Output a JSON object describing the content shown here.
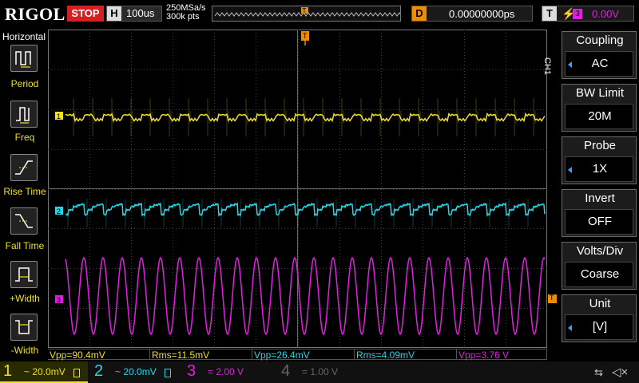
{
  "header": {
    "brand": "RIGOL",
    "run_state": "STOP",
    "horizontal_badge": "H",
    "timebase": "100us",
    "sample_rate": "250MSa/s",
    "memory_depth": "300k pts",
    "trigger_pos_marker": "T",
    "delay_badge": "D",
    "delay": "0.00000000ps",
    "trigger_badge": "T",
    "trigger_edge": "⚡",
    "trigger_source": "3",
    "trigger_level": "0.00V"
  },
  "left_panel": {
    "title": "Horizontal",
    "buttons": [
      {
        "label": "Period",
        "icon": "period-icon"
      },
      {
        "label": "Freq",
        "icon": "freq-icon"
      },
      {
        "label": "Rise Time",
        "icon": "rise-time-icon"
      },
      {
        "label": "Fall Time",
        "icon": "fall-time-icon"
      },
      {
        "label": "+Width",
        "icon": "pos-width-icon"
      },
      {
        "label": "-Width",
        "icon": "neg-width-icon"
      }
    ]
  },
  "right_menu": {
    "channel_label": "CH1",
    "items": [
      {
        "title": "Coupling",
        "value": "AC"
      },
      {
        "title": "BW Limit",
        "value": "20M"
      },
      {
        "title": "Probe",
        "value": "1X"
      },
      {
        "title": "Invert",
        "value": "OFF"
      },
      {
        "title": "Volts/Div",
        "value": "Coarse"
      },
      {
        "title": "Unit",
        "value": "[V]"
      }
    ]
  },
  "markers": {
    "ch1": "1",
    "ch2": "2",
    "ch3": "3",
    "trigger_level": "T",
    "trigger_top": "T"
  },
  "measurements": [
    {
      "text": "Vpp=90.4mV",
      "color": "#f0e020"
    },
    {
      "text": "Rms=11.5mV",
      "color": "#f0e020"
    },
    {
      "text": "Vpp=26.4mV",
      "color": "#22d8e8"
    },
    {
      "text": "Rms=4.09mV",
      "color": "#22d8e8"
    },
    {
      "text": "Vpp=3.76 V",
      "color": "#e020e0"
    }
  ],
  "channels": [
    {
      "num": "1",
      "setting": "~ 20.0mV",
      "color": "#f0e020"
    },
    {
      "num": "2",
      "setting": "~ 20.0mV",
      "color": "#22d8e8"
    },
    {
      "num": "3",
      "setting": "=   2.00 V",
      "color": "#e020e0"
    },
    {
      "num": "4",
      "setting": "=   1.00 V",
      "color": "#666666"
    }
  ],
  "status": {
    "usb_icon": "usb-icon",
    "sound_icon": "sound-muted-icon"
  },
  "colors": {
    "ch1": "#f0e020",
    "ch2": "#22d8e8",
    "ch3": "#e020e0",
    "trigger": "#f08c00",
    "stop": "#d42020"
  }
}
